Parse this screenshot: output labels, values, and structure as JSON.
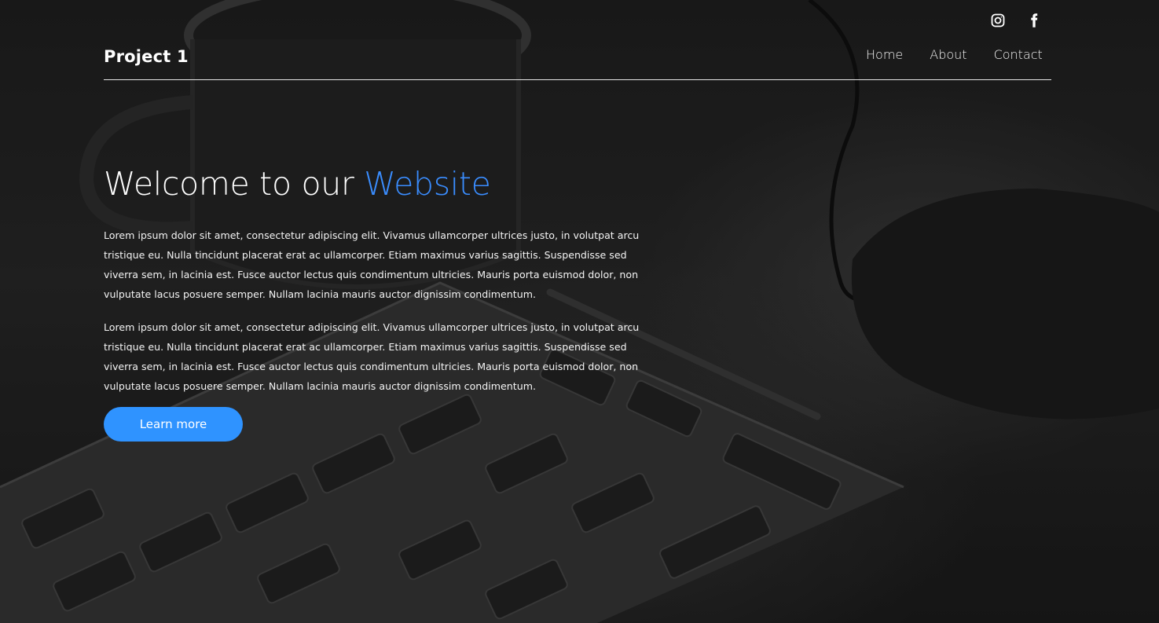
{
  "brand": {
    "name": "Project 1"
  },
  "social": {
    "instagram_icon": "instagram-icon",
    "facebook_icon": "facebook-icon"
  },
  "nav": {
    "items": [
      {
        "label": "Home"
      },
      {
        "label": "About"
      },
      {
        "label": "Contact"
      }
    ]
  },
  "hero": {
    "headline_prefix": "Welcome to our",
    "headline_accent": "Website",
    "paragraphs": [
      "Lorem ipsum dolor sit amet, consectetur adipiscing elit. Vivamus ullamcorper ultrices justo, in volutpat arcu tristique eu. Nulla tincidunt placerat erat ac ullamcorper. Etiam maximus varius sagittis. Suspendisse sed viverra sem, in lacinia est. Fusce auctor lectus quis condimentum ultricies. Mauris porta euismod dolor, non vulputate lacus posuere semper. Nullam lacinia mauris auctor dignissim condimentum.",
      "Lorem ipsum dolor sit amet, consectetur adipiscing elit. Vivamus ullamcorper ultrices justo, in volutpat arcu tristique eu. Nulla tincidunt placerat erat ac ullamcorper. Etiam maximus varius sagittis. Suspendisse sed viverra sem, in lacinia est. Fusce auctor lectus quis condimentum ultricies. Mauris porta euismod dolor, non vulputate lacus posuere semper. Nullam lacinia mauris auctor dignissim condimentum."
    ],
    "cta_label": "Learn more"
  },
  "colors": {
    "accent": "#3a8dff",
    "button": "#2f93ff",
    "text": "#ffffff",
    "background": "#1e1e1e"
  }
}
